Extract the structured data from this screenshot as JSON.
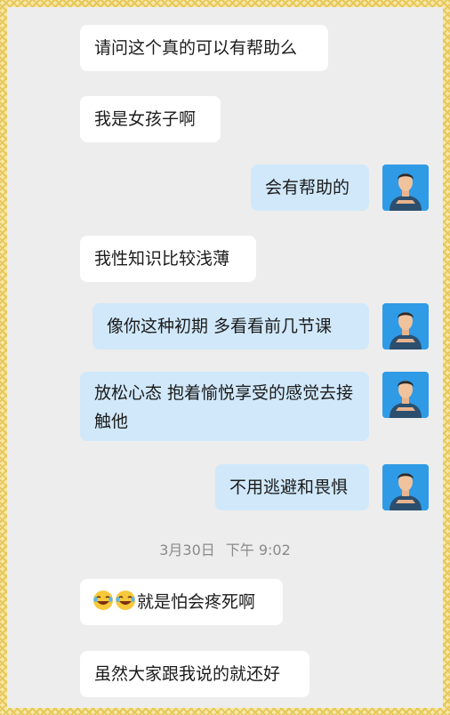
{
  "messages": [
    {
      "side": "left",
      "text": "请问这个真的可以有帮助么"
    },
    {
      "side": "left",
      "text": "我是女孩子啊"
    },
    {
      "side": "right",
      "text": "会有帮助的"
    },
    {
      "side": "left",
      "text": "我性知识比较浅薄"
    },
    {
      "side": "right",
      "text": "像你这种初期 多看看前几节课"
    },
    {
      "side": "right",
      "text": "放松心态  抱着愉悦享受的感觉去接触他"
    },
    {
      "side": "right",
      "text": "不用逃避和畏惧"
    },
    {
      "side": "left",
      "text": "就是怕会疼死啊",
      "emoji": "laughing-tears-emoji"
    },
    {
      "side": "left",
      "text": "虽然大家跟我说的就还好"
    }
  ],
  "timestamp": {
    "date": "3月30日",
    "time": "下午 9:02"
  },
  "colors": {
    "chat_background": "#ededed",
    "incoming_bubble": "#ffffff",
    "outgoing_bubble": "#d0e8fa",
    "border_pattern": "#e7c75a",
    "avatar_background": "#2f9be6"
  },
  "icons": {
    "avatar": "man-avatar-icon"
  }
}
